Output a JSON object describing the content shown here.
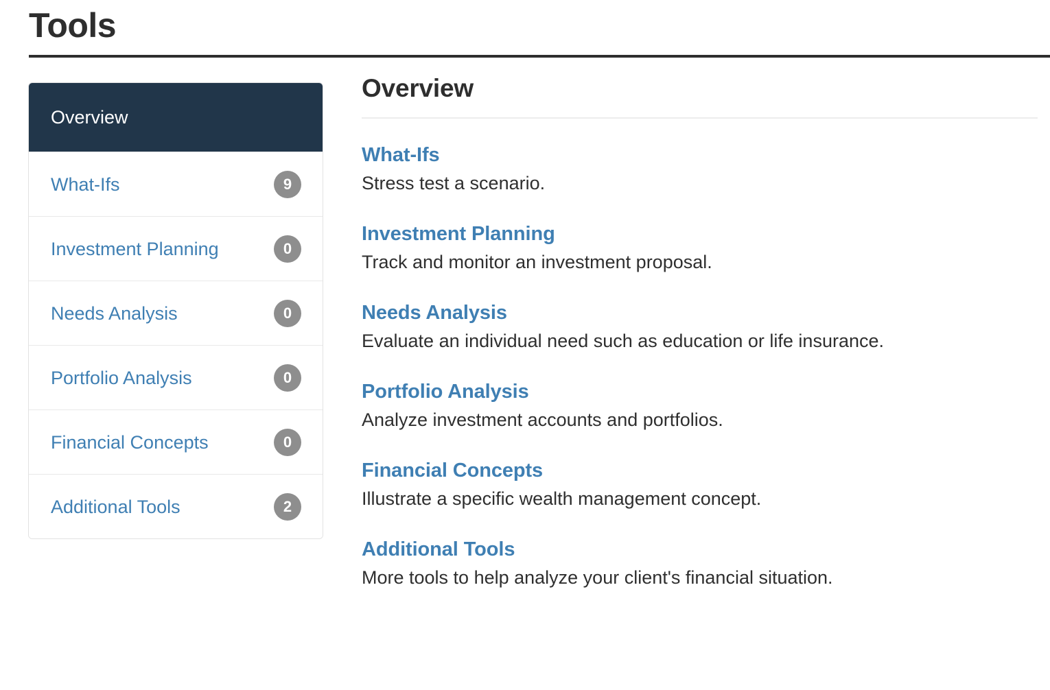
{
  "header": {
    "title": "Tools"
  },
  "colors": {
    "active_nav_background": "#21364a",
    "link_blue": "#3f7fb3",
    "badge_gray": "#8e8e8e",
    "header_rule": "#2e2e2e",
    "text_dark": "#2f2f2f"
  },
  "sidebar": {
    "items": [
      {
        "label": "Overview",
        "badge": null,
        "active": true
      },
      {
        "label": "What-Ifs",
        "badge": "9",
        "active": false
      },
      {
        "label": "Investment Planning",
        "badge": "0",
        "active": false
      },
      {
        "label": "Needs Analysis",
        "badge": "0",
        "active": false
      },
      {
        "label": "Portfolio Analysis",
        "badge": "0",
        "active": false
      },
      {
        "label": "Financial Concepts",
        "badge": "0",
        "active": false
      },
      {
        "label": "Additional Tools",
        "badge": "2",
        "active": false
      }
    ]
  },
  "main": {
    "title": "Overview",
    "tools": [
      {
        "name": "What-Ifs",
        "description": "Stress test a scenario."
      },
      {
        "name": "Investment Planning",
        "description": "Track and monitor an investment proposal."
      },
      {
        "name": "Needs Analysis",
        "description": "Evaluate an individual need such as education or life insurance."
      },
      {
        "name": "Portfolio Analysis",
        "description": "Analyze investment accounts and portfolios."
      },
      {
        "name": "Financial Concepts",
        "description": "Illustrate a specific wealth management concept."
      },
      {
        "name": "Additional Tools",
        "description": "More tools to help analyze your client's financial situation."
      }
    ]
  }
}
